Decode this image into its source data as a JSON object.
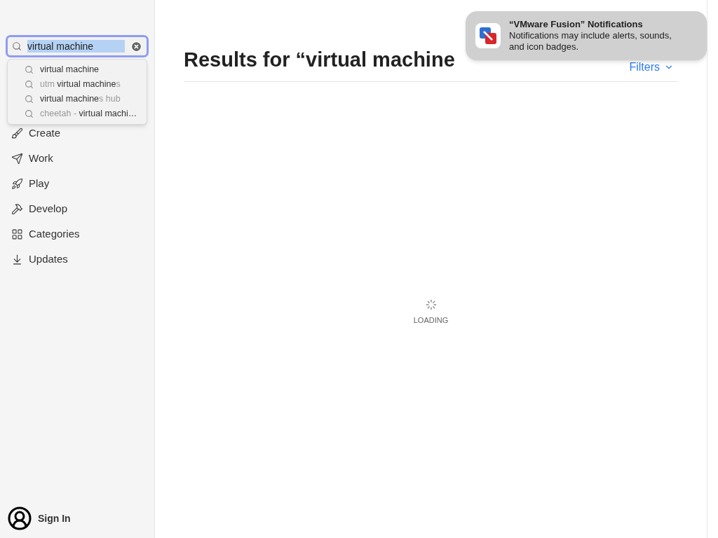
{
  "search": {
    "value": "virtual machine",
    "suggestions": [
      {
        "parts": [
          {
            "text": "virtual machine",
            "dim": false
          }
        ]
      },
      {
        "parts": [
          {
            "text": "utm ",
            "dim": true
          },
          {
            "text": "virtual machine",
            "dim": false
          },
          {
            "text": "s",
            "dim": true
          }
        ]
      },
      {
        "parts": [
          {
            "text": "virtual machine",
            "dim": false
          },
          {
            "text": "s hub",
            "dim": true
          }
        ]
      },
      {
        "parts": [
          {
            "text": "cheetah - ",
            "dim": true
          },
          {
            "text": "virtual machi…",
            "dim": false
          }
        ]
      }
    ]
  },
  "sidebar": {
    "items": [
      {
        "label": "Create"
      },
      {
        "label": "Work"
      },
      {
        "label": "Play"
      },
      {
        "label": "Develop"
      },
      {
        "label": "Categories"
      },
      {
        "label": "Updates"
      }
    ],
    "account": "Sign In"
  },
  "main": {
    "title": "Results for “virtual machine",
    "filters": "Filters",
    "loading": "LOADING"
  },
  "notification": {
    "title": "“VMware Fusion” Notifications",
    "body": "Notifications may include alerts, sounds, and icon badges."
  }
}
